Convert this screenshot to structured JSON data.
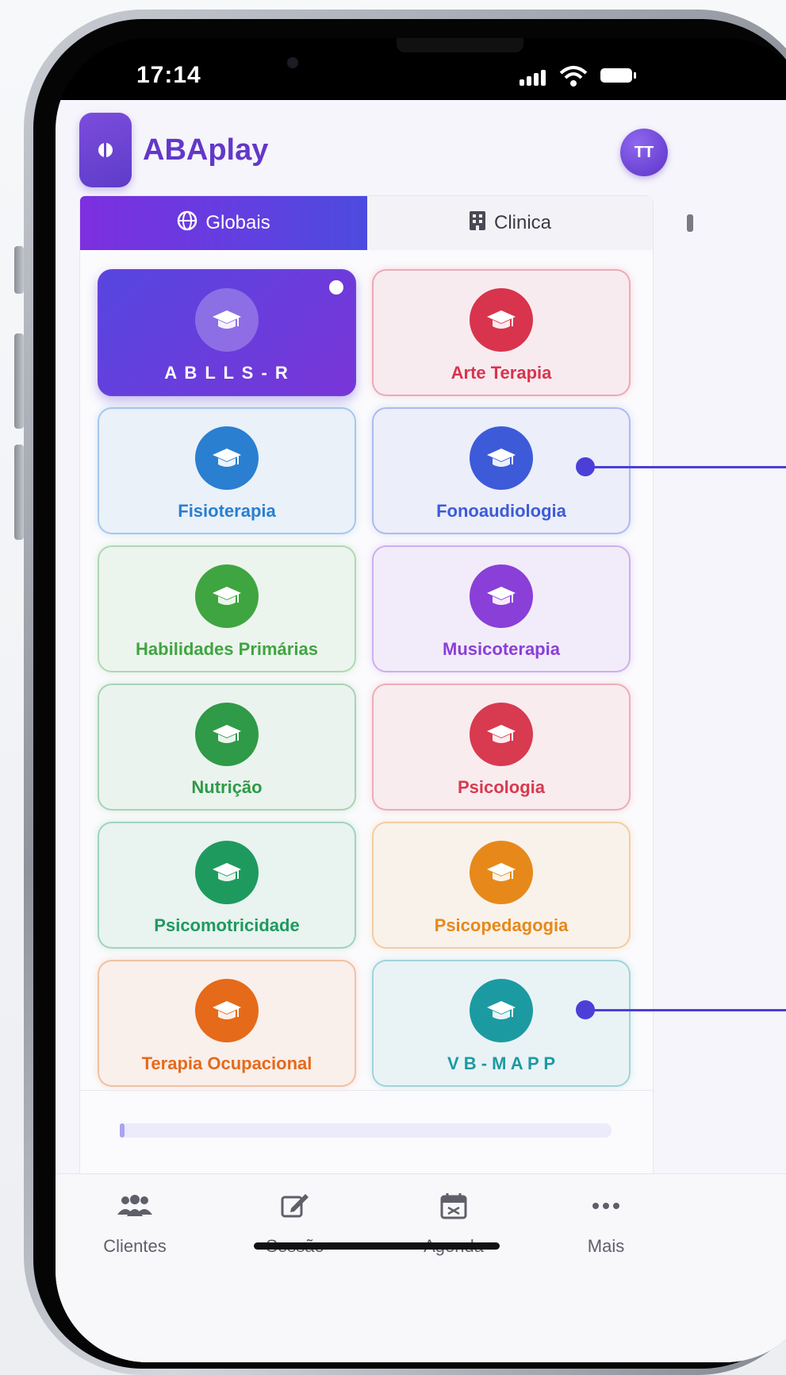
{
  "status_bar": {
    "time": "17:14"
  },
  "app": {
    "title": "ABAplay",
    "avatar_initials": "TT",
    "brand_color": "#6238c8"
  },
  "tabs": [
    {
      "label": "Globais",
      "icon": "globe-icon",
      "active": true
    },
    {
      "label": "Clinica",
      "icon": "building-icon",
      "active": false
    }
  ],
  "tiles": [
    {
      "label": "A B L L S - R",
      "color": "#5b3fdc",
      "selected": true
    },
    {
      "label": "Arte Terapia",
      "color": "#d8344d",
      "selected": false
    },
    {
      "label": "Fisioterapia",
      "color": "#2a7fd0",
      "selected": false
    },
    {
      "label": "Fonoaudiologia",
      "color": "#3d5bd8",
      "selected": false
    },
    {
      "label": "Habilidades Primárias",
      "color": "#3fa540",
      "selected": false
    },
    {
      "label": "Musicoterapia",
      "color": "#8a3fd8",
      "selected": false
    },
    {
      "label": "Nutrição",
      "color": "#2f9a47",
      "selected": false
    },
    {
      "label": "Psicologia",
      "color": "#d83a4f",
      "selected": false
    },
    {
      "label": "Psicomotricidade",
      "color": "#1e9a5f",
      "selected": false
    },
    {
      "label": "Psicopedagogia",
      "color": "#e6891a",
      "selected": false
    },
    {
      "label": "Terapia Ocupacional",
      "color": "#e56a1a",
      "selected": false
    },
    {
      "label": "V B - M A P P",
      "color": "#1c9aa2",
      "selected": false
    }
  ],
  "bottom_nav": [
    {
      "label": "Clientes",
      "icon": "users-icon"
    },
    {
      "label": "Sessão",
      "icon": "edit-icon"
    },
    {
      "label": "Agenda",
      "icon": "calendar-icon"
    },
    {
      "label": "Mais",
      "icon": "more-icon"
    }
  ]
}
